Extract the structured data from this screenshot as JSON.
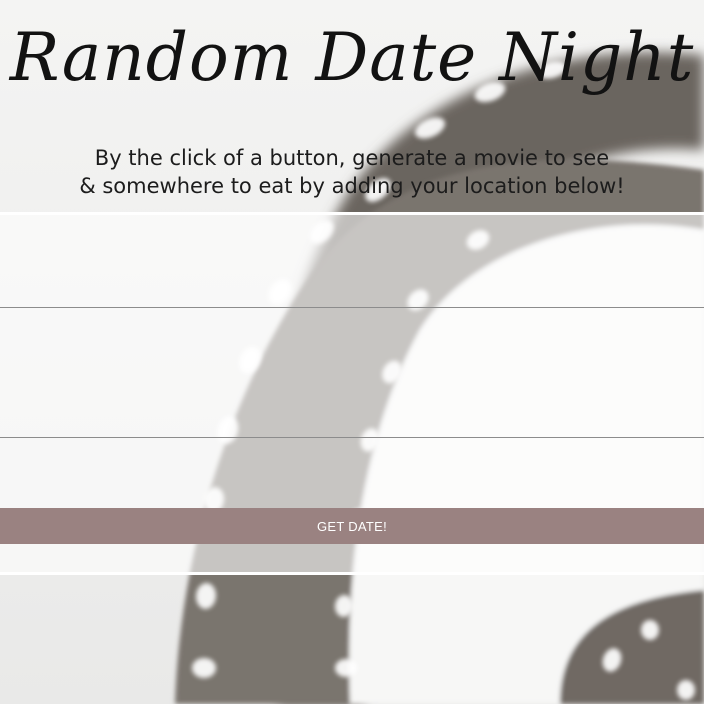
{
  "header": {
    "title": "Random Date Night",
    "subtitle_line1": "By the click of a button, generate a movie to see",
    "subtitle_line2": "& somewhere to eat by adding your location below!"
  },
  "form": {
    "field_1": {
      "value": "",
      "placeholder": ""
    },
    "field_2": {
      "value": "",
      "placeholder": ""
    },
    "submit_label": "GET DATE!"
  },
  "colors": {
    "button_bg": "#9a8281",
    "film_strip": "#6e6863",
    "page_bg": "#f1f1f0"
  },
  "background": {
    "image": "film-reel-photo"
  }
}
